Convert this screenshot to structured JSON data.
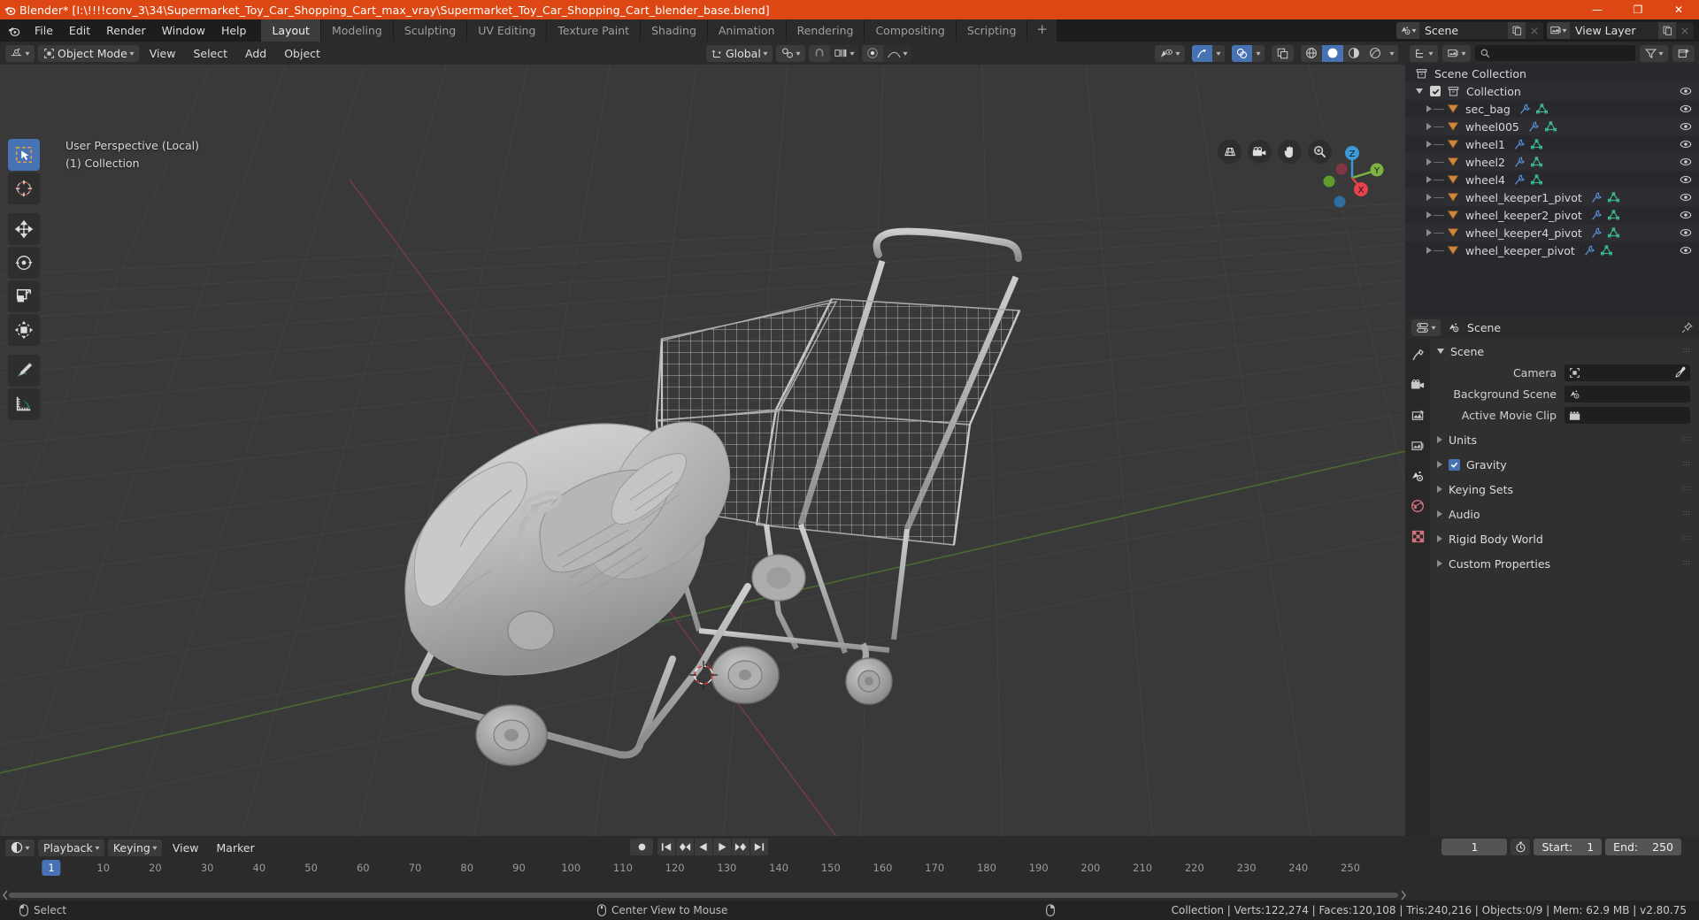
{
  "window": {
    "title": "Blender* [I:\\!!!!conv_3\\34\\Supermarket_Toy_Car_Shopping_Cart_max_vray\\Supermarket_Toy_Car_Shopping_Cart_blender_base.blend]",
    "minimize": "—",
    "maximize": "❐",
    "close": "✕",
    "accent": "#dd4713"
  },
  "topbar": {
    "menus": [
      "File",
      "Edit",
      "Render",
      "Window",
      "Help"
    ],
    "workspaces": [
      {
        "label": "Layout",
        "active": true
      },
      {
        "label": "Modeling",
        "active": false
      },
      {
        "label": "Sculpting",
        "active": false
      },
      {
        "label": "UV Editing",
        "active": false
      },
      {
        "label": "Texture Paint",
        "active": false
      },
      {
        "label": "Shading",
        "active": false
      },
      {
        "label": "Animation",
        "active": false
      },
      {
        "label": "Rendering",
        "active": false
      },
      {
        "label": "Compositing",
        "active": false
      },
      {
        "label": "Scripting",
        "active": false
      }
    ],
    "add_workspace": "+",
    "scene_name": "Scene",
    "view_layer_name": "View Layer"
  },
  "viewport": {
    "mode": "Object Mode",
    "menus": [
      "View",
      "Select",
      "Add",
      "Object"
    ],
    "transform_orientation": "Global",
    "overlay_line1": "User Perspective (Local)",
    "overlay_line2": "(1) Collection",
    "gizmo_axes": [
      "X",
      "Y",
      "Z"
    ],
    "tools": [
      {
        "name": "select-box-tool",
        "active": true
      },
      {
        "name": "cursor-tool",
        "active": false
      },
      {
        "name": "move-tool",
        "active": false
      },
      {
        "name": "rotate-tool",
        "active": false
      },
      {
        "name": "scale-tool",
        "active": false
      },
      {
        "name": "transform-tool",
        "active": false
      },
      {
        "name": "annotate-tool",
        "active": false
      },
      {
        "name": "measure-tool",
        "active": false
      }
    ]
  },
  "outliner": {
    "search_placeholder": "",
    "root": "Scene Collection",
    "collection": "Collection",
    "items": [
      {
        "label": "sec_bag"
      },
      {
        "label": "wheel005"
      },
      {
        "label": "wheel1"
      },
      {
        "label": "wheel2"
      },
      {
        "label": "wheel4"
      },
      {
        "label": "wheel_keeper1_pivot"
      },
      {
        "label": "wheel_keeper2_pivot"
      },
      {
        "label": "wheel_keeper4_pivot"
      },
      {
        "label": "wheel_keeper_pivot"
      }
    ]
  },
  "properties": {
    "breadcrumb": "Scene",
    "panel_title": "Scene",
    "fields": [
      {
        "label": "Camera",
        "value": ""
      },
      {
        "label": "Background Scene",
        "value": ""
      },
      {
        "label": "Active Movie Clip",
        "value": ""
      }
    ],
    "sections": [
      {
        "label": "Units",
        "checkbox": false
      },
      {
        "label": "Gravity",
        "checkbox": true
      },
      {
        "label": "Keying Sets",
        "checkbox": false
      },
      {
        "label": "Audio",
        "checkbox": false
      },
      {
        "label": "Rigid Body World",
        "checkbox": false
      },
      {
        "label": "Custom Properties",
        "checkbox": false
      }
    ]
  },
  "timeline": {
    "menus": [
      "Playback",
      "Keying",
      "View",
      "Marker"
    ],
    "current_frame": "1",
    "start_label": "Start:",
    "start_value": "1",
    "end_label": "End:",
    "end_value": "250",
    "ticks": [
      "10",
      "20",
      "30",
      "40",
      "50",
      "60",
      "70",
      "80",
      "90",
      "100",
      "110",
      "120",
      "130",
      "140",
      "150",
      "160",
      "170",
      "180",
      "190",
      "200",
      "210",
      "220",
      "230",
      "240",
      "250"
    ],
    "playhead_label": "1"
  },
  "statusbar": {
    "left_action": "Select",
    "mid_action": "Center View to Mouse",
    "stats": "Collection | Verts:122,274 | Faces:120,108 | Tris:240,216 | Objects:0/9 | Mem: 62.9 MB | v2.80.75"
  }
}
